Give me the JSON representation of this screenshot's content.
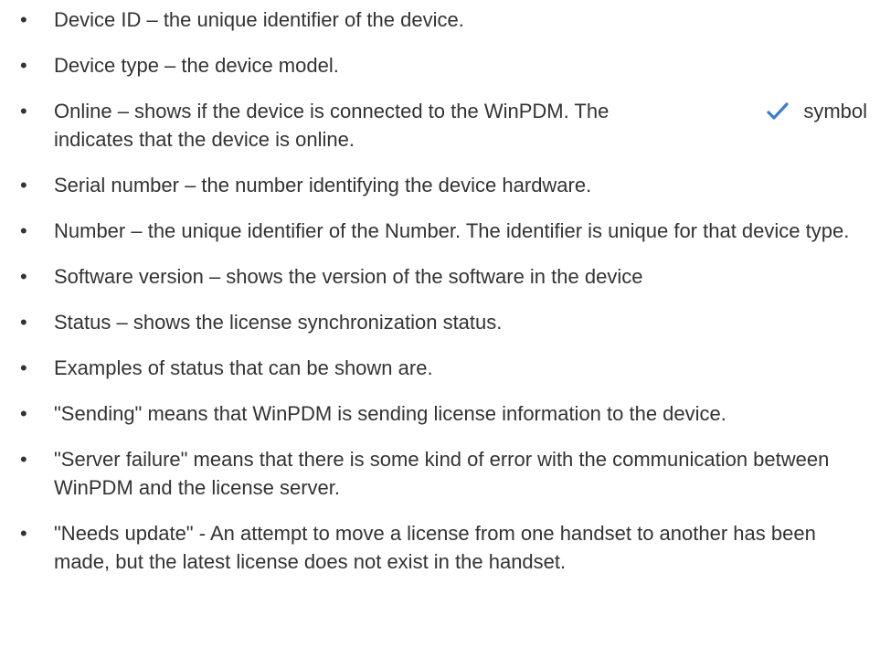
{
  "bullet_glyph": "•",
  "items": [
    {
      "text": "Device ID – the unique identifier of the device."
    },
    {
      "text": "Device type – the device model."
    },
    {
      "before_icon": "Online – shows if the device is connected to the WinPDM. The",
      "icon": "checkmark-icon",
      "after_icon": "symbol",
      "continuation": "indicates that the device is online."
    },
    {
      "text": "Serial number – the number identifying the device hardware."
    },
    {
      "text": "Number – the unique identifier of the Number. The identifier is unique for that device type."
    },
    {
      "text": "Software version – shows the version of the software in the device"
    },
    {
      "text": "Status – shows the license synchronization status."
    },
    {
      "text": "Examples of status that can be shown are."
    },
    {
      "text": "\"Sending\" means that WinPDM is sending license information to the device."
    },
    {
      "text": "\"Server failure\" means that there is some kind of error with the communication between WinPDM and the license server."
    },
    {
      "text": "\"Needs update\" -  An attempt to move a license from one handset to another has been made, but the latest license does not exist in the handset."
    }
  ],
  "colors": {
    "text": "#333333",
    "check": "#3b7bd4",
    "background": "#ffffff"
  }
}
